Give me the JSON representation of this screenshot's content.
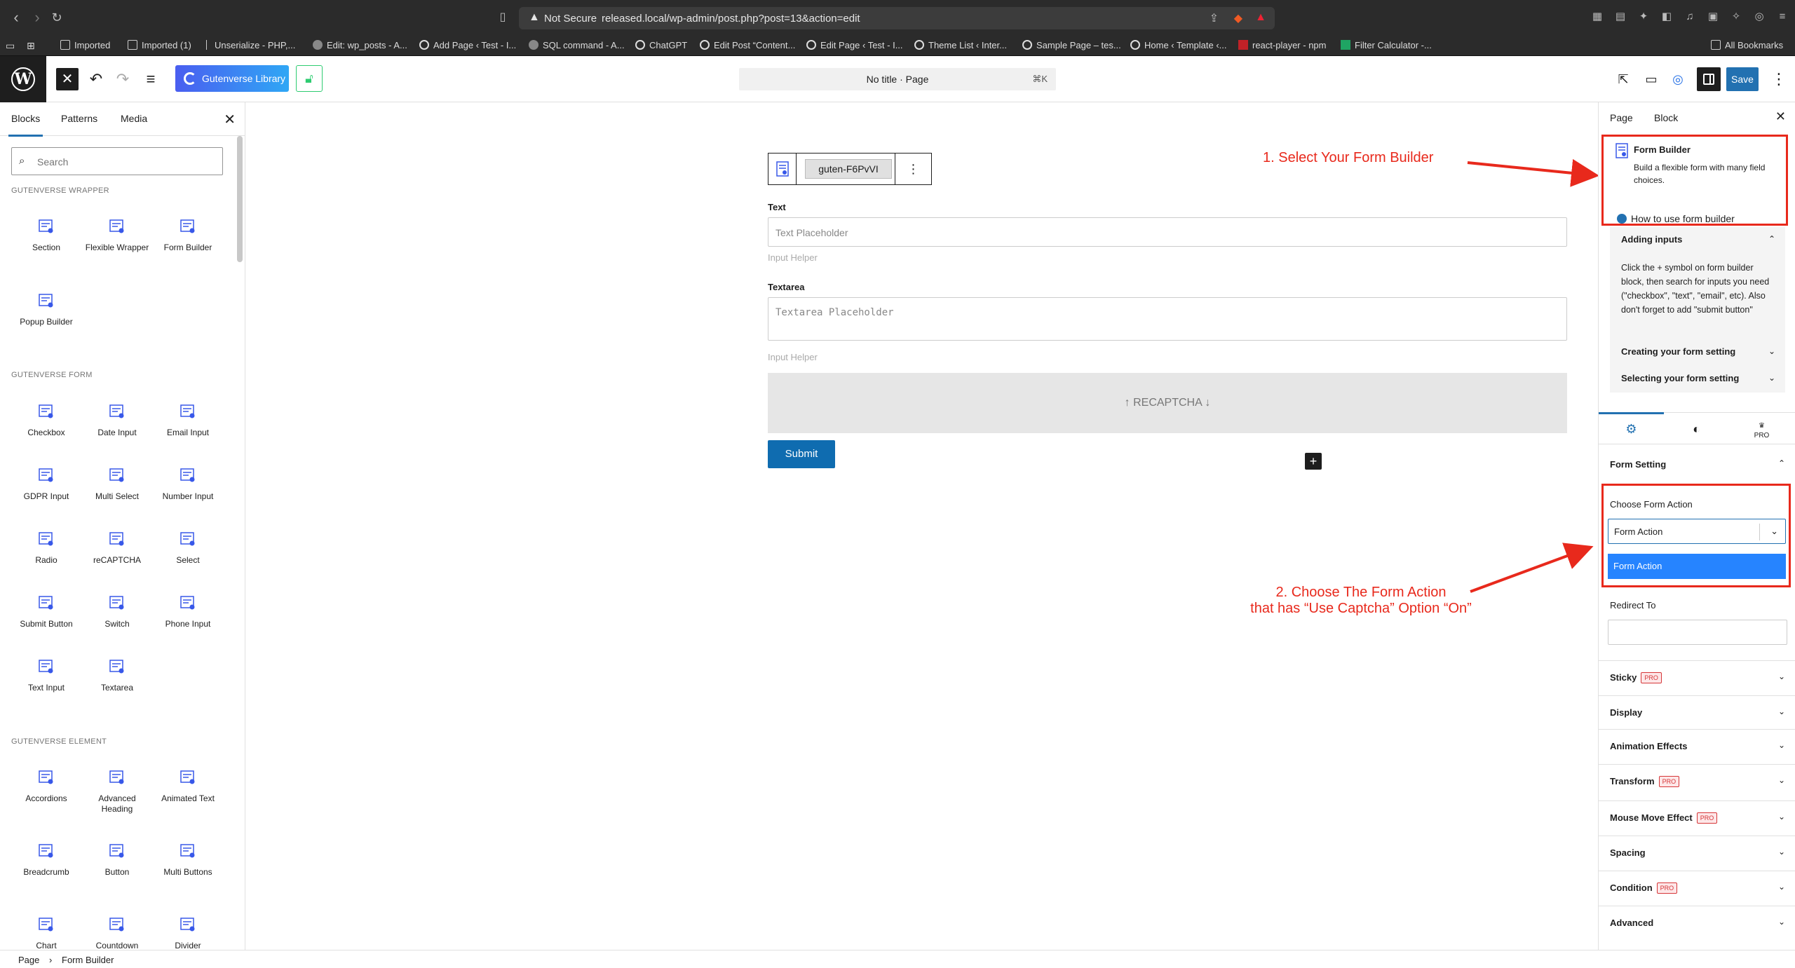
{
  "browser": {
    "not_secure": "Not Secure",
    "url": "released.local/wp-admin/post.php?post=13&action=edit",
    "bookmarks": [
      "Imported",
      "Imported (1)",
      "Unserialize - PHP,...",
      "Edit: wp_posts - A...",
      "Add Page ‹ Test - I...",
      "SQL command - A...",
      "ChatGPT",
      "Edit Post “Content...",
      "Edit Page ‹ Test - I...",
      "Theme List ‹ Inter...",
      "Sample Page – tes...",
      "Home ‹ Template ‹...",
      "react-player - npm",
      "Filter Calculator -..."
    ],
    "all_bookmarks": "All Bookmarks"
  },
  "toolbar": {
    "library_label": "Gutenverse Library",
    "doc_title": "No title · Page",
    "shortcut": "⌘K",
    "save_label": "Save"
  },
  "inserter": {
    "tabs": [
      "Blocks",
      "Patterns",
      "Media"
    ],
    "search_placeholder": "Search",
    "categories": [
      {
        "title": "GUTENVERSE WRAPPER",
        "blocks": [
          {
            "label": "Section",
            "icon": "section-icon"
          },
          {
            "label": "Flexible Wrapper",
            "icon": "flexible-wrapper-icon"
          },
          {
            "label": "Form Builder",
            "icon": "form-builder-icon"
          },
          {
            "label": "Popup Builder",
            "icon": "popup-builder-icon"
          }
        ]
      },
      {
        "title": "GUTENVERSE FORM",
        "blocks": [
          {
            "label": "Checkbox",
            "icon": "checkbox-icon"
          },
          {
            "label": "Date Input",
            "icon": "date-input-icon"
          },
          {
            "label": "Email Input",
            "icon": "email-input-icon"
          },
          {
            "label": "GDPR Input",
            "icon": "gdpr-input-icon"
          },
          {
            "label": "Multi Select",
            "icon": "multi-select-icon"
          },
          {
            "label": "Number Input",
            "icon": "number-input-icon"
          },
          {
            "label": "Radio",
            "icon": "radio-icon"
          },
          {
            "label": "reCAPTCHA",
            "icon": "recaptcha-icon"
          },
          {
            "label": "Select",
            "icon": "select-icon"
          },
          {
            "label": "Submit Button",
            "icon": "submit-button-icon"
          },
          {
            "label": "Switch",
            "icon": "switch-icon"
          },
          {
            "label": "Phone Input",
            "icon": "phone-input-icon"
          },
          {
            "label": "Text Input",
            "icon": "text-input-icon"
          },
          {
            "label": "Textarea",
            "icon": "textarea-icon"
          }
        ]
      },
      {
        "title": "GUTENVERSE ELEMENT",
        "blocks": [
          {
            "label": "Accordions",
            "icon": "accordions-icon"
          },
          {
            "label": "Advanced Heading",
            "icon": "advanced-heading-icon"
          },
          {
            "label": "Animated Text",
            "icon": "animated-text-icon"
          },
          {
            "label": "Breadcrumb",
            "icon": "breadcrumb-icon"
          },
          {
            "label": "Button",
            "icon": "button-icon"
          },
          {
            "label": "Multi Buttons",
            "icon": "multi-buttons-icon"
          },
          {
            "label": "Chart",
            "icon": "chart-icon"
          },
          {
            "label": "Countdown",
            "icon": "countdown-icon"
          },
          {
            "label": "Divider",
            "icon": "divider-icon"
          }
        ]
      }
    ]
  },
  "canvas": {
    "block_id": "guten-F6PvVI",
    "fields": [
      {
        "label": "Text",
        "placeholder": "Text Placeholder",
        "helper": "Input Helper"
      },
      {
        "label": "Textarea",
        "placeholder": "Textarea Placeholder",
        "helper": "Input Helper"
      }
    ],
    "recaptcha": "↑ RECAPTCHA ↓",
    "submit": "Submit"
  },
  "annotations": {
    "step1": "1. Select Your Form Builder",
    "step2_line1": "2. Choose The Form Action",
    "step2_line2": "that has “Use Captcha” Option “On”"
  },
  "settings": {
    "tabs": [
      "Page",
      "Block"
    ],
    "block_title": "Form Builder",
    "block_desc": "Build a flexible form with many field choices.",
    "howto": "How to use form builder",
    "accordion": [
      {
        "title": "Adding inputs",
        "open": true
      },
      {
        "title": "Creating your form setting",
        "open": false
      },
      {
        "title": "Selecting your form setting",
        "open": false
      }
    ],
    "adding_inputs_body": "Click the + symbol on form builder block, then search for inputs you need (\"checkbox\", \"text\", \"email\", etc). Also don't forget to add \"submit button\"",
    "icon_tabs": [
      "settings-icon",
      "style-icon",
      "pro-icon"
    ],
    "pro_label": "PRO",
    "form_setting": "Form Setting",
    "choose_form_action": "Choose Form Action",
    "form_action_value": "Form Action",
    "form_action_option": "Form Action",
    "redirect_to": "Redirect To",
    "sections": [
      {
        "name": "Sticky",
        "pro": true
      },
      {
        "name": "Display",
        "pro": false
      },
      {
        "name": "Animation Effects",
        "pro": false
      },
      {
        "name": "Transform",
        "pro": true
      },
      {
        "name": "Mouse Move Effect",
        "pro": true
      },
      {
        "name": "Spacing",
        "pro": false
      },
      {
        "name": "Condition",
        "pro": true
      },
      {
        "name": "Advanced",
        "pro": false
      }
    ]
  },
  "footer": {
    "crumbs": [
      "Page",
      "Form Builder"
    ]
  },
  "colors": {
    "accent": "#2271b1",
    "annotation": "#e8291c",
    "option_bg": "#2684ff"
  }
}
